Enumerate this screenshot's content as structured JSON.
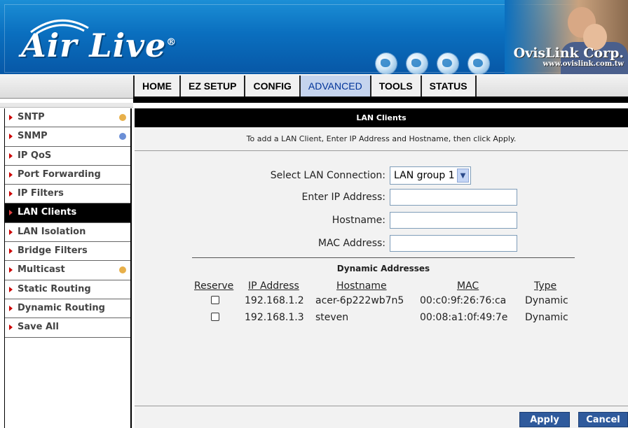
{
  "brand": {
    "logo_text": "Air Live",
    "company": "OvisLink Corp.",
    "url": "www.ovislink.com.tw"
  },
  "nav": {
    "tabs": [
      {
        "label": "HOME",
        "active": false
      },
      {
        "label": "EZ SETUP",
        "active": false
      },
      {
        "label": "CONFIG",
        "active": false
      },
      {
        "label": "ADVANCED",
        "active": true
      },
      {
        "label": "TOOLS",
        "active": false
      },
      {
        "label": "STATUS",
        "active": false
      }
    ]
  },
  "sidebar": {
    "items": [
      {
        "label": "SNTP",
        "dot": "#e8b04a"
      },
      {
        "label": "SNMP",
        "dot": "#6b8fd6"
      },
      {
        "label": "IP QoS",
        "dot": ""
      },
      {
        "label": "Port Forwarding",
        "dot": ""
      },
      {
        "label": "IP Filters",
        "dot": ""
      },
      {
        "label": "LAN Clients",
        "dot": "",
        "active": true
      },
      {
        "label": "LAN Isolation",
        "dot": ""
      },
      {
        "label": "Bridge Filters",
        "dot": ""
      },
      {
        "label": "Multicast",
        "dot": "#e8b04a"
      },
      {
        "label": "Static Routing",
        "dot": ""
      },
      {
        "label": "Dynamic Routing",
        "dot": ""
      },
      {
        "label": "Save All",
        "dot": ""
      }
    ]
  },
  "panel": {
    "title": "LAN Clients",
    "instructions": "To add a LAN Client, Enter IP Address and Hostname, then click Apply."
  },
  "form": {
    "select_label": "Select LAN Connection:",
    "select_value": "LAN group 1",
    "ip_label": "Enter IP Address:",
    "ip_value": "",
    "hostname_label": "Hostname:",
    "hostname_value": "",
    "mac_label": "MAC Address:",
    "mac_value": ""
  },
  "dynamic": {
    "title": "Dynamic Addresses",
    "headers": {
      "reserve": "Reserve",
      "ip": "IP Address",
      "hostname": "Hostname",
      "mac": "MAC",
      "type": "Type"
    },
    "rows": [
      {
        "reserved": false,
        "ip": "192.168.1.2",
        "hostname": "acer-6p222wb7n5",
        "mac": "00:c0:9f:26:76:ca",
        "type": "Dynamic"
      },
      {
        "reserved": false,
        "ip": "192.168.1.3",
        "hostname": "steven",
        "mac": "00:08:a1:0f:49:7e",
        "type": "Dynamic"
      }
    ]
  },
  "buttons": {
    "apply": "Apply",
    "cancel": "Cancel"
  },
  "colors": {
    "header_blue": "#0a6fbf",
    "active_tab": "#c5d4ee",
    "button_blue": "#2f5a9c",
    "arrow_red": "#cc0000"
  }
}
